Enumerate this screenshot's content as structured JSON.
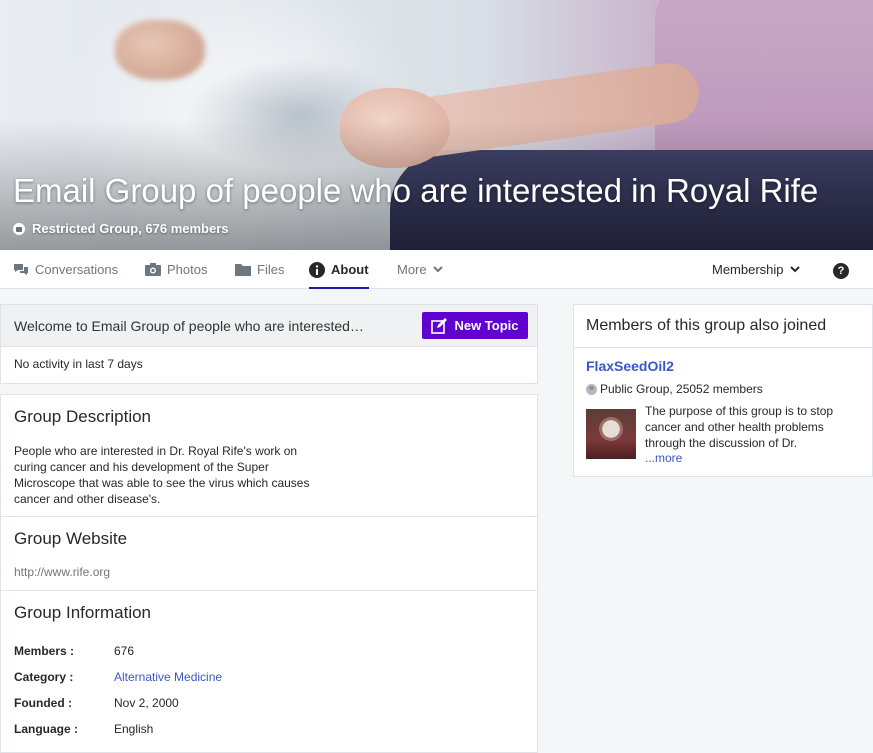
{
  "hero": {
    "title": "Email Group of people who are interested in Royal Rife",
    "subtitle": "Restricted Group, 676 members"
  },
  "tabs": {
    "conversations": "Conversations",
    "photos": "Photos",
    "files": "Files",
    "about": "About",
    "more": "More",
    "membership": "Membership",
    "help": "?"
  },
  "welcome": {
    "text": "Welcome to Email Group of people who are interested…",
    "new_topic": "New Topic",
    "activity": "No activity in last 7 days"
  },
  "about": {
    "description_title": "Group Description",
    "description": "People who are interested in Dr. Royal Rife's work on curing cancer and his development of the Super Microscope that was able to see the virus which causes cancer and other disease's.",
    "website_title": "Group Website",
    "website": "http://www.rife.org",
    "info_title": "Group Information",
    "info": [
      {
        "label": "Members :",
        "value": "676"
      },
      {
        "label": "Category :",
        "value": "Alternative Medicine"
      },
      {
        "label": "Founded :",
        "value": "Nov 2, 2000"
      },
      {
        "label": "Language :",
        "value": "English"
      }
    ]
  },
  "sidebar": {
    "title": "Members of this group also joined",
    "group_name": "FlaxSeedOil2",
    "group_meta": "Public Group, 25052 members",
    "group_desc": "The purpose of this group is to stop cancer and other health problems through the discussion of Dr.",
    "more": "...more"
  },
  "colors": {
    "accent": "#6001d2",
    "link": "#3a57c6",
    "active_tab": "#1d1da3"
  }
}
